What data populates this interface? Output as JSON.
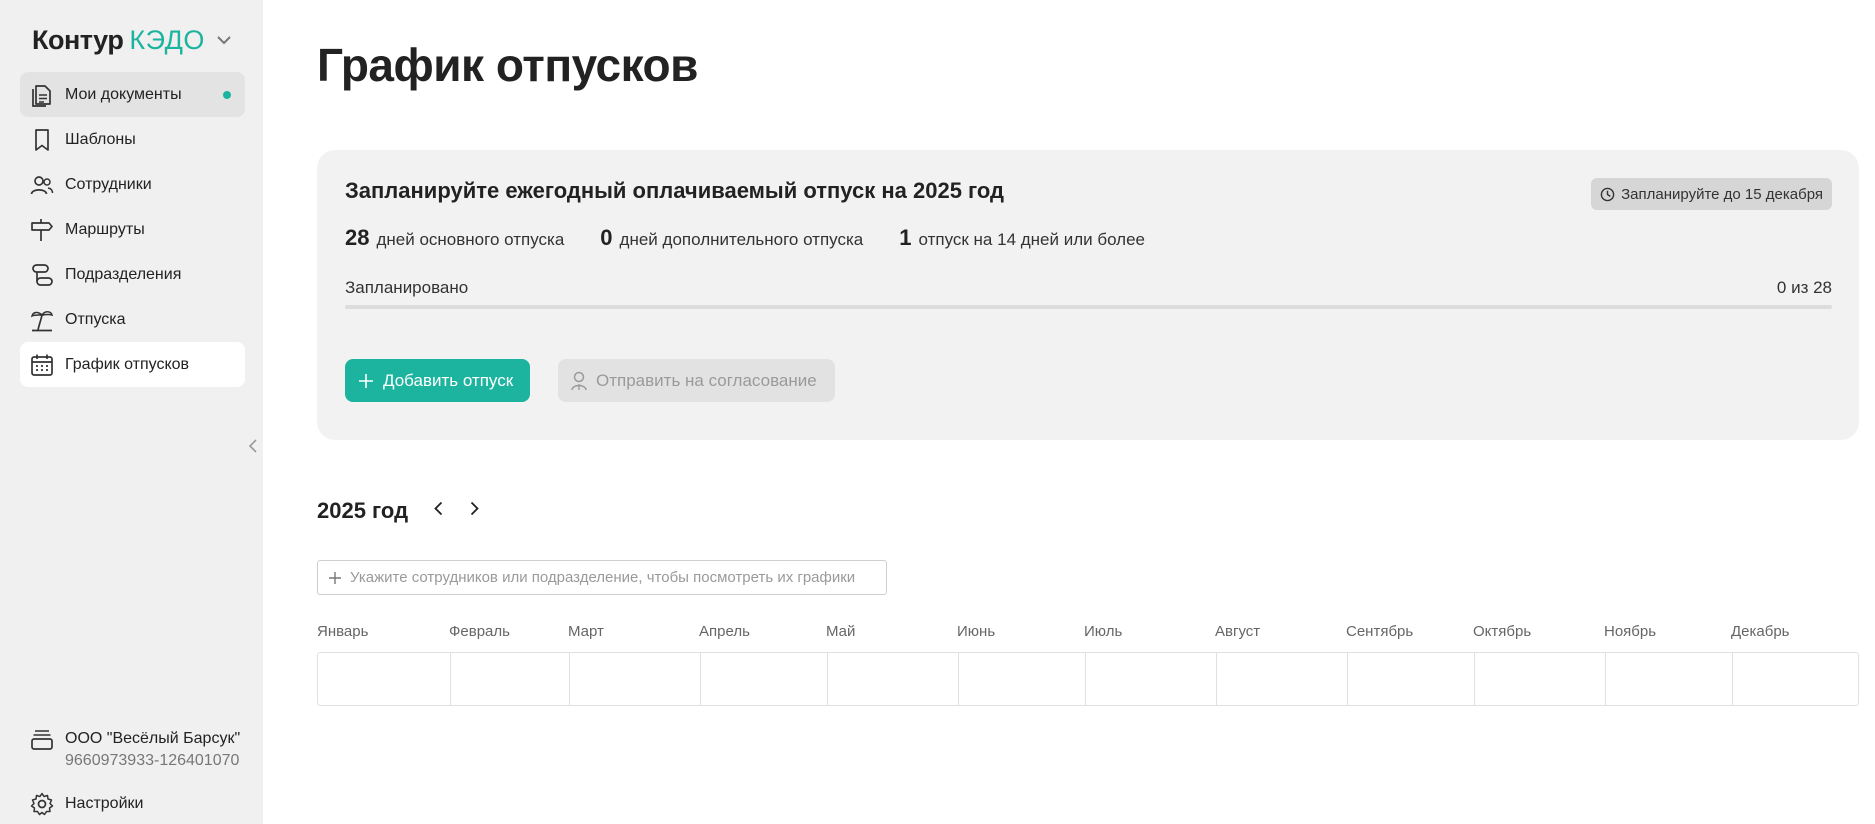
{
  "app": {
    "logo_main": "Контур",
    "logo_accent": "КЭДО"
  },
  "sidebar": {
    "items": [
      {
        "label": "Мои документы",
        "icon": "document-icon"
      },
      {
        "label": "Шаблоны",
        "icon": "bookmark-icon"
      },
      {
        "label": "Сотрудники",
        "icon": "users-icon"
      },
      {
        "label": "Маршруты",
        "icon": "signpost-icon"
      },
      {
        "label": "Подразделения",
        "icon": "hierarchy-icon"
      },
      {
        "label": "Отпуска",
        "icon": "palm-icon"
      },
      {
        "label": "График отпусков",
        "icon": "calendar-icon"
      }
    ],
    "org_name": "ООО \"Весёлый Барсук\"",
    "org_inn": "9660973933-126401070",
    "settings_label": "Настройки"
  },
  "main": {
    "title": "График отпусков",
    "card": {
      "title": "Запланируйте ежегодный оплачиваемый отпуск на 2025 год",
      "deadline": "Запланируйте до 15 декабря",
      "stats": [
        {
          "num": "28",
          "text": "дней основного отпуска"
        },
        {
          "num": "0",
          "text": "дней дополнительного отпуска"
        },
        {
          "num": "1",
          "text": "отпуск на 14 дней или более"
        }
      ],
      "planned_label": "Запланировано",
      "planned_count": "0 из 28",
      "planned_progress": 0,
      "add_button": "Добавить отпуск",
      "send_button": "Отправить на согласование"
    },
    "year_label": "2025 год",
    "filter_placeholder": "Укажите сотрудников или подразделение, чтобы посмотреть их графики",
    "months": [
      "Январь",
      "Февраль",
      "Март",
      "Апрель",
      "Май",
      "Июнь",
      "Июль",
      "Август",
      "Сентябрь",
      "Октябрь",
      "Ноябрь",
      "Декабрь"
    ]
  },
  "colors": {
    "accent": "#1db49f",
    "sidebar_bg": "#f0f0f0",
    "card_bg": "#f2f2f2"
  }
}
